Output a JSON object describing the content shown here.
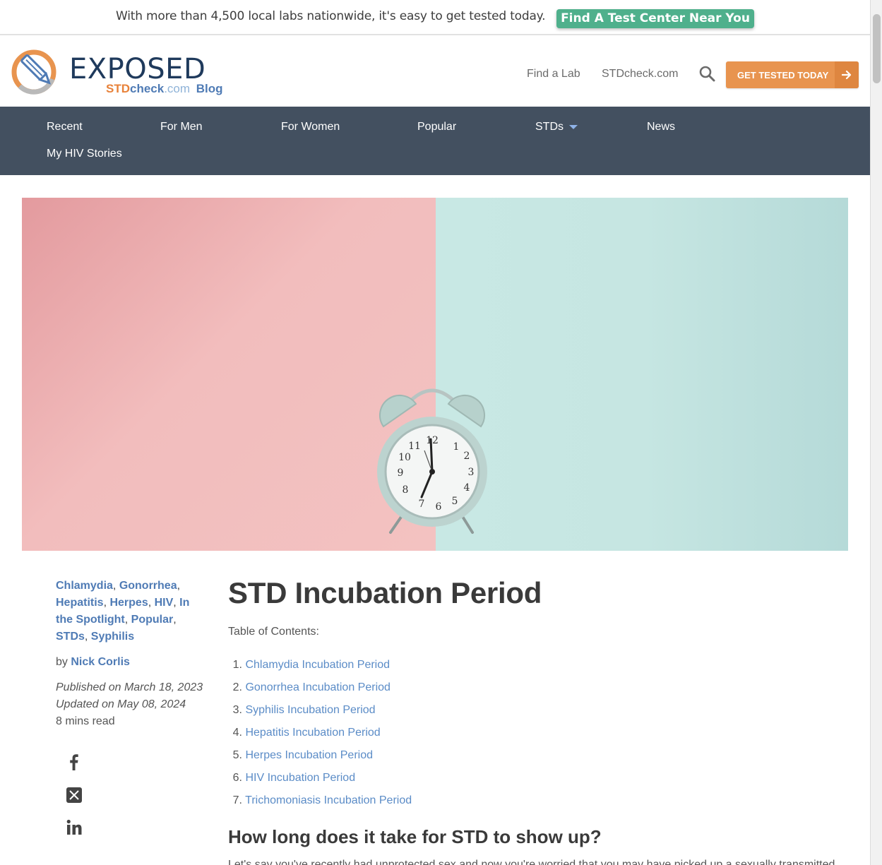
{
  "promo": {
    "text": "With more than 4,500 local labs nationwide, it's easy to get tested today.",
    "button": "Find A Test Center Near You"
  },
  "logo": {
    "word": "EXPOSED",
    "std": "STD",
    "check": "check",
    "com": ".com",
    "blog": "Blog"
  },
  "header": {
    "find_lab": "Find a Lab",
    "stdcheck": "STDcheck.com",
    "cta": "GET TESTED TODAY"
  },
  "nav": {
    "items": [
      "Recent",
      "For Men",
      "For Women",
      "Popular",
      "STDs",
      "News",
      "My HIV Stories"
    ]
  },
  "meta": {
    "categories": [
      "Chlamydia",
      "Gonorrhea",
      "Hepatitis",
      "Herpes",
      "HIV",
      "In the Spotlight",
      "Popular",
      "STDs",
      "Syphilis"
    ],
    "by": "by",
    "author": "Nick Corlis",
    "published": "Published on March 18, 2023",
    "updated": "Updated on May 08, 2024",
    "read_time": "8 mins read"
  },
  "article": {
    "title": "STD Incubation Period",
    "toc_label": "Table of Contents:",
    "toc": [
      "Chlamydia Incubation Period",
      "Gonorrhea Incubation Period",
      "Syphilis Incubation Period",
      "Hepatitis Incubation Period",
      "Herpes Incubation Period",
      "HIV Incubation Period",
      "Trichomoniasis Incubation Period"
    ],
    "toc_numbers": [
      "1.",
      "2.",
      "3.",
      "4.",
      "5.",
      "6.",
      "7."
    ],
    "heading": "How long does it take for STD to show up?",
    "paragraph": "Let's say you've recently had unprotected sex and now you're worried that you may have picked up a sexually transmitted"
  },
  "colors": {
    "promo_button": "#4fb08c",
    "nav_bg": "#435060",
    "cta": "#e8944f",
    "link": "#4f7bb5",
    "hero_left": "#f2bdbd",
    "hero_right": "#c8e8e4"
  }
}
